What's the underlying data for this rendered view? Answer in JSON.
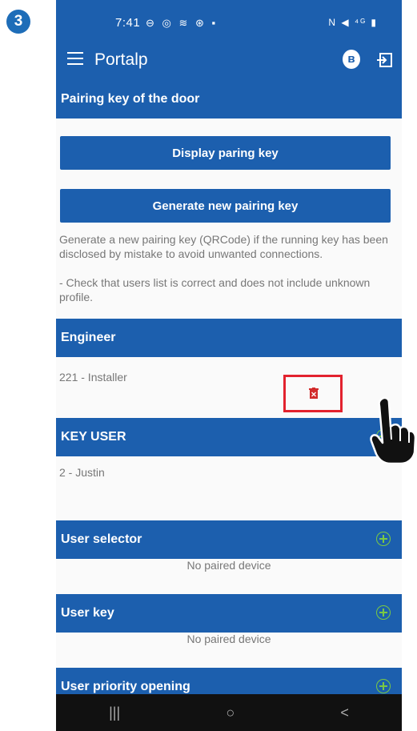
{
  "step": "3",
  "status_bar": {
    "time": "7:41",
    "left_icons": "⊖ ◎ ≋ ⊛ ▪",
    "right_icons": "N ◀ ⁴ᴳ ▮"
  },
  "app_bar": {
    "title": "Portalp",
    "bluetooth_icon": "bluetooth-icon",
    "exit_icon": "exit-icon"
  },
  "pairing": {
    "header": "Pairing key of the door",
    "display_button": "Display paring key",
    "generate_button": "Generate new pairing key",
    "help_1": "Generate a new pairing key (QRCode) if the running key has been disclosed by mistake to avoid unwanted connections.",
    "help_2": "- Check that users list is correct and does not include unknown profile."
  },
  "engineer": {
    "header": "Engineer",
    "user": "221 - Installer",
    "delete_icon": "trash-icon"
  },
  "key_user": {
    "header": "KEY USER",
    "user": "2 - Justin"
  },
  "user_selector": {
    "header": "User selector",
    "empty": "No paired device"
  },
  "user_key": {
    "header": "User key",
    "empty": "No paired device"
  },
  "user_priority": {
    "header": "User priority opening"
  },
  "nav_bar": {
    "recents": "|||",
    "home": "○",
    "back": "<"
  },
  "colors": {
    "primary": "#1c5fae",
    "add": "#7ac943",
    "highlight": "#e2222e",
    "delete": "#d22b2b"
  }
}
